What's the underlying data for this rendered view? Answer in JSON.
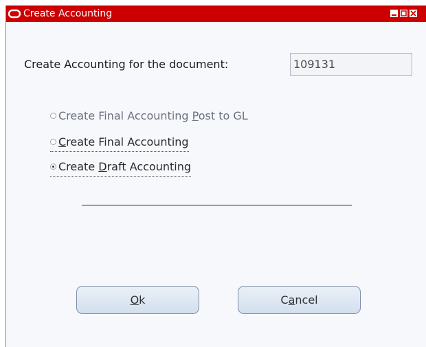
{
  "window": {
    "title": "Create Accounting",
    "title_bar_color": "#cc0000",
    "icons": [
      "oracle-logo-icon",
      "minimize-icon",
      "maximize-icon",
      "close-icon"
    ]
  },
  "form": {
    "document_label": "Create Accounting for the document:",
    "document_value": "109131"
  },
  "options": [
    {
      "pre": "Create Final Accounting ",
      "mnemonic": "P",
      "post": "ost to GL",
      "selected": false,
      "enabled": false
    },
    {
      "pre": "",
      "mnemonic": "C",
      "post": "reate Final Accounting",
      "selected": false,
      "enabled": true
    },
    {
      "pre": "Create ",
      "mnemonic": "D",
      "post": "raft Accounting",
      "selected": true,
      "enabled": true
    }
  ],
  "buttons": {
    "ok": {
      "pre": "",
      "mnemonic": "O",
      "post": "k"
    },
    "cancel": {
      "pre": "C",
      "mnemonic": "a",
      "post": "ncel"
    }
  }
}
